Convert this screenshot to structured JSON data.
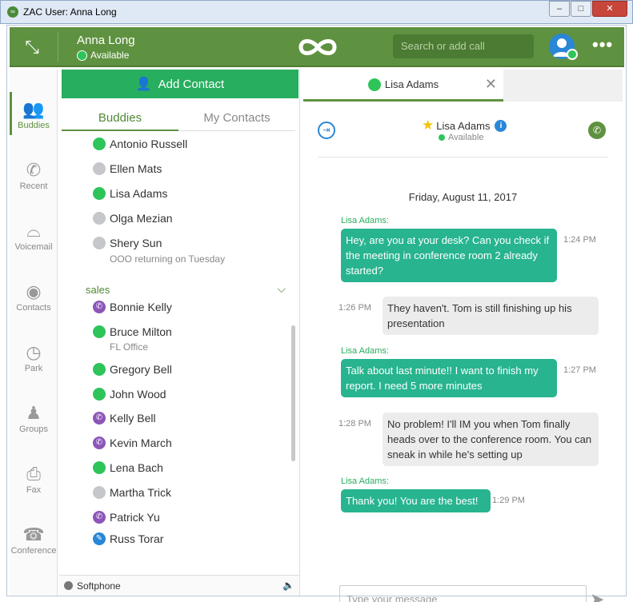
{
  "window": {
    "title": "ZAC User: Anna Long",
    "controls": {
      "minimize": "–",
      "maximize": "□",
      "close": "✕"
    }
  },
  "header": {
    "user_name": "Anna Long",
    "user_status": "Available",
    "search_placeholder": "Search or add call",
    "more_label": "•••"
  },
  "nav": [
    {
      "label": "Buddies",
      "icon": "buddies-icon",
      "glyph": "👥",
      "active": true
    },
    {
      "label": "Recent",
      "icon": "phone-icon",
      "glyph": "✆",
      "active": false
    },
    {
      "label": "Voicemail",
      "icon": "voicemail-icon",
      "glyph": "⌓",
      "active": false
    },
    {
      "label": "Contacts",
      "icon": "contact-icon",
      "glyph": "◉",
      "active": false
    },
    {
      "label": "Park",
      "icon": "park-icon",
      "glyph": "◷",
      "active": false
    },
    {
      "label": "Groups",
      "icon": "groups-icon",
      "glyph": "♟",
      "active": false
    },
    {
      "label": "Fax",
      "icon": "fax-icon",
      "glyph": "⎙",
      "active": false
    },
    {
      "label": "Conference",
      "icon": "conference-icon",
      "glyph": "☎",
      "active": false
    }
  ],
  "contacts_panel": {
    "add_label": "Add Contact",
    "tabs": [
      "Buddies",
      "My Contacts"
    ],
    "buddies": [
      {
        "name": "Antonio  Russell",
        "status": "available",
        "note": ""
      },
      {
        "name": "Ellen Mats",
        "status": "offline",
        "note": ""
      },
      {
        "name": "Lisa Adams",
        "status": "available",
        "note": ""
      },
      {
        "name": "Olga Mezian",
        "status": "offline",
        "note": ""
      },
      {
        "name": "Shery Sun",
        "status": "offline",
        "note": "OOO returning on Tuesday"
      }
    ],
    "group_name": "sales",
    "group_members": [
      {
        "name": "Bonnie Kelly",
        "status": "on-call",
        "note": ""
      },
      {
        "name": "Bruce Milton",
        "status": "available",
        "note": "FL Office"
      },
      {
        "name": "Gregory Bell",
        "status": "available",
        "note": ""
      },
      {
        "name": "John Wood",
        "status": "available",
        "note": ""
      },
      {
        "name": "Kelly Bell",
        "status": "on-call",
        "note": ""
      },
      {
        "name": "Kevin March",
        "status": "on-call",
        "note": ""
      },
      {
        "name": "Lena Bach",
        "status": "available",
        "note": ""
      },
      {
        "name": "Martha Trick",
        "status": "offline",
        "note": ""
      },
      {
        "name": "Patrick Yu",
        "status": "on-call",
        "note": ""
      },
      {
        "name": "Russ Torar",
        "status": "busy",
        "note": ""
      }
    ],
    "softphone_label": "Softphone"
  },
  "chat": {
    "tab_label": "Lisa Adams",
    "contact_name": "Lisa Adams",
    "contact_status": "Available",
    "date": "Friday, August 11, 2017",
    "messages": [
      {
        "from": "Lisa Adams:",
        "text": "Hey, are you at your desk? Can you check if the meeting in conference room 2 already started?",
        "time": "1:24 PM",
        "mine": true
      },
      {
        "from": "",
        "text": "They haven't. Tom is still finishing up his presentation",
        "time": "1:26 PM",
        "mine": false
      },
      {
        "from": "Lisa Adams:",
        "text": "Talk about last minute!! I want to finish my report. I need 5 more minutes",
        "time": "1:27 PM",
        "mine": true
      },
      {
        "from": "",
        "text": "No problem! I'll IM you when Tom finally heads over to the conference room. You can sneak in while he's setting up",
        "time": "1:28 PM",
        "mine": false
      },
      {
        "from": "Lisa Adams:",
        "text": "Thank you! You are the best!",
        "time": "1:29 PM",
        "mine": true
      }
    ],
    "input_placeholder": "Type your message"
  },
  "colors": {
    "brand": "#5f9240",
    "accent_green": "#27ae5f",
    "bubble_mine": "#27b48f",
    "available": "#2ec45a",
    "on_call": "#8c55b8"
  }
}
